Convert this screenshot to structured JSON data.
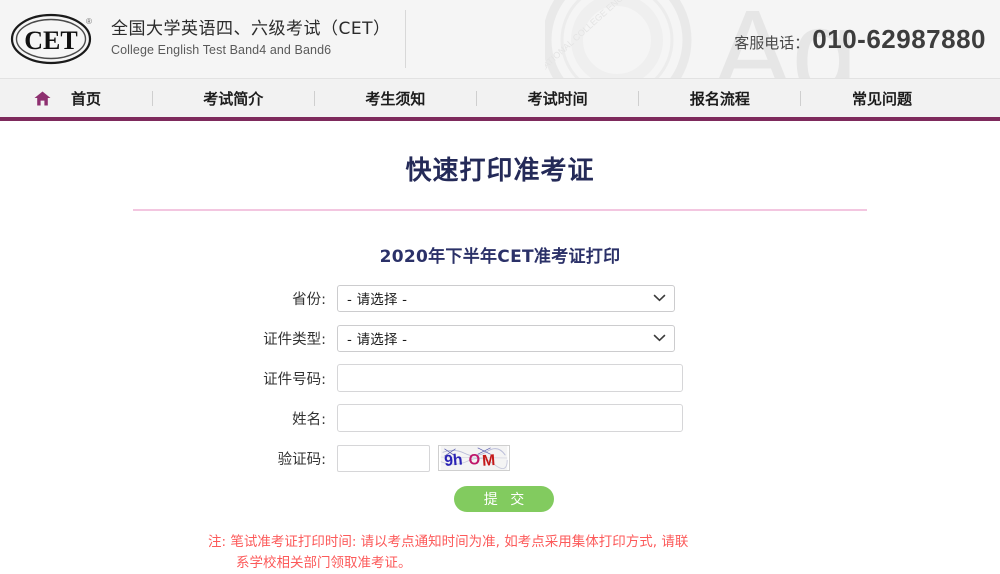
{
  "header": {
    "logo_text": "CET",
    "logo_registered": "®",
    "brand_cn": "全国大学英语四、六级考试（CET）",
    "brand_en": "College English Test Band4 and Band6",
    "hotline_label": "客服电话：",
    "hotline_number": "010-62987880",
    "watermark_letters": "Ag"
  },
  "nav": {
    "home_icon": "home-icon",
    "items": [
      {
        "label": "首页"
      },
      {
        "label": "考试简介"
      },
      {
        "label": "考生须知"
      },
      {
        "label": "考试时间"
      },
      {
        "label": "报名流程"
      },
      {
        "label": "常见问题"
      }
    ]
  },
  "main": {
    "page_title": "快速打印准考证",
    "sub_title": "2020年下半年CET准考证打印"
  },
  "form": {
    "fields": [
      {
        "label": "省份:",
        "type": "select",
        "value": "- 请选择 -",
        "name": "province"
      },
      {
        "label": "证件类型:",
        "type": "select",
        "value": "- 请选择 -",
        "name": "id-type"
      },
      {
        "label": "证件号码:",
        "type": "text",
        "value": "",
        "placeholder": "",
        "name": "id-number"
      },
      {
        "label": "姓名:",
        "type": "text",
        "value": "",
        "placeholder": "",
        "name": "full-name"
      },
      {
        "label": "验证码:",
        "type": "captcha",
        "value": "",
        "placeholder": "",
        "name": "captcha"
      }
    ],
    "captcha_text": "9hOM",
    "submit_label": "提 交"
  },
  "note": {
    "line1": "注: 笔试准考证打印时间: 请以考点通知时间为准, 如考点采用集体打印方式, 请联",
    "line2": "系学校相关部门领取准考证。"
  },
  "colors": {
    "nav_border": "#7e2a5c",
    "title": "#242a58",
    "rule": "#f3c6e0",
    "submit": "#82cb5f",
    "note": "#fc5a5a",
    "home_icon": "#8e3070"
  }
}
